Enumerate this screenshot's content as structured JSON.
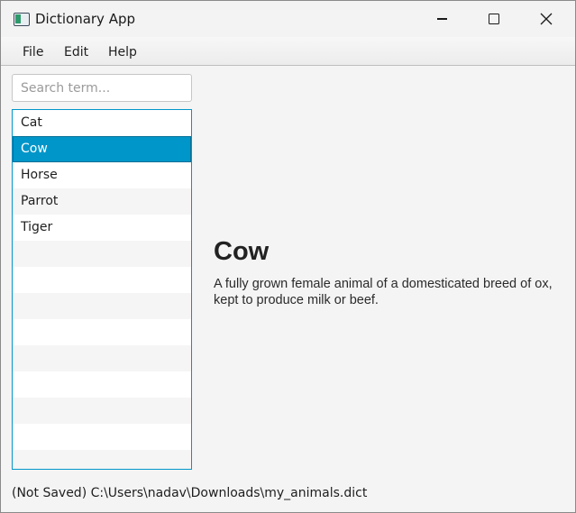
{
  "window": {
    "title": "Dictionary App",
    "icon": "app-window-icon",
    "controls": [
      "minimize-icon",
      "maximize-icon",
      "close-icon"
    ]
  },
  "menu": {
    "file": "File",
    "edit": "Edit",
    "help": "Help"
  },
  "search": {
    "placeholder": "Search term...",
    "value": ""
  },
  "list": {
    "items": [
      "Cat",
      "Cow",
      "Horse",
      "Parrot",
      "Tiger"
    ],
    "selected": "Cow",
    "accent_color": "#0096c9"
  },
  "detail": {
    "term": "Cow",
    "definition": "A fully grown female animal of a domesticated breed of ox, kept to produce milk or beef."
  },
  "status": {
    "text": "(Not Saved) C:\\Users\\nadav\\Downloads\\my_animals.dict"
  }
}
